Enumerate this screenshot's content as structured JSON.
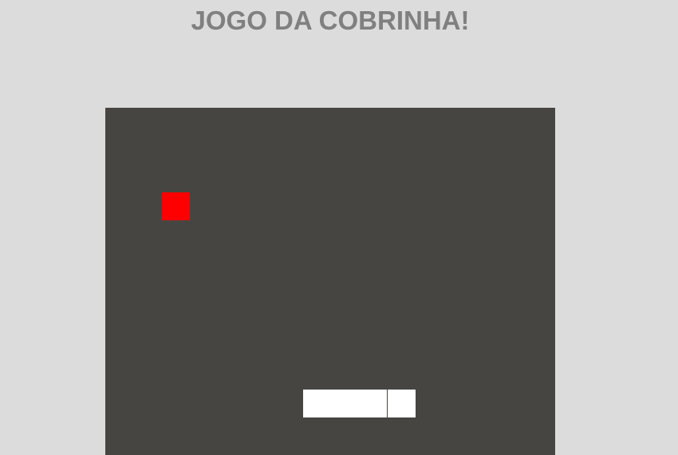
{
  "header": {
    "title": "JOGO DA COBRINHA!"
  },
  "colors": {
    "page_background": "#dcdcdc",
    "title_color": "#808080",
    "board_background": "#464541",
    "food_color": "#ff0000",
    "snake_color": "#ffffff"
  },
  "game": {
    "grid_unit": "cell",
    "food": {
      "col": 2,
      "row": 3
    },
    "snake": [
      {
        "col": 7,
        "row": 10
      },
      {
        "col": 8,
        "row": 10
      },
      {
        "col": 9,
        "row": 10
      },
      {
        "col": 10,
        "row": 10
      }
    ]
  }
}
